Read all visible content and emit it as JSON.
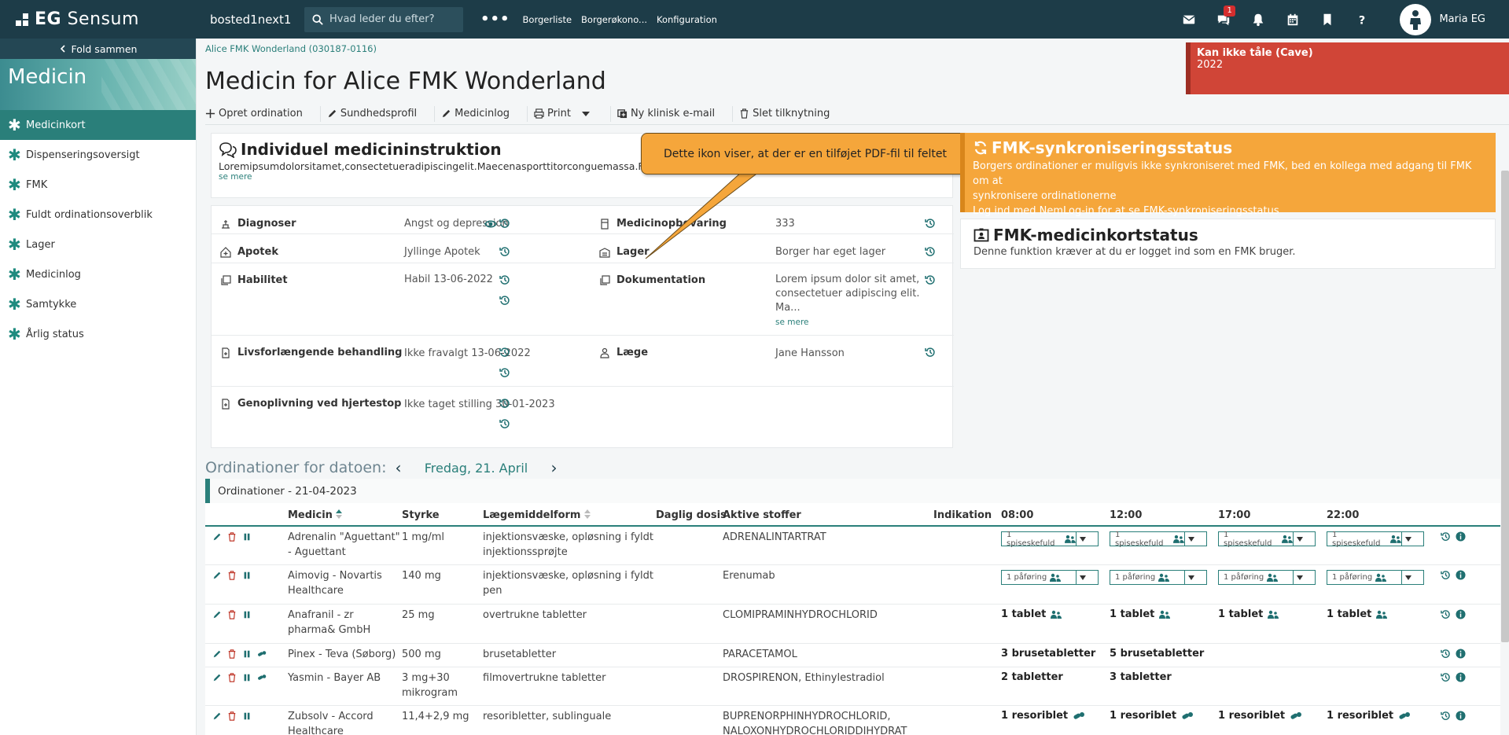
{
  "topbar": {
    "brand_prefix": "EG",
    "brand_name": "Sensum",
    "tenant": "bosted1next1",
    "search_placeholder": "Hvad leder du efter?",
    "more_label": "•••",
    "nav": [
      "Borgerliste",
      "Borgerøkono...",
      "Konfiguration"
    ],
    "chat_badge": "1",
    "user_name": "Maria EG"
  },
  "sidebar": {
    "collapse_label": "Fold sammen",
    "title": "Medicin",
    "items": [
      "Medicinkort",
      "Dispenseringsoversigt",
      "FMK",
      "Fuldt ordinationsoverblik",
      "Lager",
      "Medicinlog",
      "Samtykke",
      "Årlig status"
    ],
    "active_index": 0
  },
  "page": {
    "breadcrumb": "Alice FMK Wonderland (030187-0116)",
    "title": "Medicin for Alice FMK Wonderland",
    "cave_title": "Kan ikke tåle (Cave)",
    "cave_value": "2022",
    "accent_color": "#2a7f7a",
    "warning_color": "#f5a63b",
    "alert_color": "#d04537"
  },
  "actions": [
    "Opret ordination",
    "Sundhedsprofil",
    "Medicinlog",
    "Print",
    "Ny klinisk e-mail",
    "Slet tilknytning"
  ],
  "instruction": {
    "title": "Individuel medicininstruktion",
    "text": "Loremipsumdolorsitamet,consectetueradipiscingelit.Maecenasporttitorconguemassa.Fuscedon",
    "more": "se mere"
  },
  "callout": "Dette ikon viser, at der er en tilføjet PDF-fil til feltet",
  "info": {
    "diagnoser_label": "Diagnoser",
    "diagnoser_value": "Angst og depression",
    "opbevaring_label": "Medicinopbevaring",
    "opbevaring_value": "333",
    "apotek_label": "Apotek",
    "apotek_value": "Jyllinge Apotek",
    "lager_label": "Lager",
    "lager_value": "Borger har eget lager",
    "habilitet_label": "Habilitet",
    "habilitet_value": "Habil 13-06-2022",
    "dokumentation_label": "Dokumentation",
    "dokumentation_value_1": "Lorem ipsum dolor sit amet,",
    "dokumentation_value_2": "consectetuer adipiscing elit.",
    "dokumentation_value_3": "Ma...",
    "dokumentation_more": "se mere",
    "livs_label": "Livsforlængende behandling",
    "livs_value": "Ikke fravalgt 13-06-2022",
    "laege_label": "Læge",
    "laege_value": "Jane Hansson",
    "genoplivning_label": "Genoplivning ved hjertestop",
    "genoplivning_value": "Ikke taget stilling 30-01-2023"
  },
  "sync": {
    "title": "FMK-synkroniseringsstatus",
    "line1": "Borgers ordinationer er muligvis ikke synkroniseret med FMK, bed en kollega med adgang til FMK om at",
    "line2": "synkronisere ordinationerne",
    "line3": "Log ind med NemLog-in for at se FMK-synkroniseringsstatus"
  },
  "fmk": {
    "title": "FMK-medicinkortstatus",
    "text": "Denne funktion kræver at du er logget ind som en FMK bruger."
  },
  "orders": {
    "heading": "Ordinationer for datoen:",
    "date": "Fredag, 21. April",
    "caption": "Ordinationer - 21-04-2023",
    "columns": {
      "medicin": "Medicin",
      "styrke": "Styrke",
      "form": "Lægemiddelform",
      "daglig": "Daglig dosis",
      "stoffer": "Aktive stoffer",
      "indikation": "Indikation",
      "t0800": "08:00",
      "t1200": "12:00",
      "t1700": "17:00",
      "t2200": "22:00"
    },
    "rows": [
      {
        "med1": "Adrenalin \"Aguettant\"",
        "med2": "- Aguettant",
        "styrke1": "1 mg/ml",
        "styrke2": "",
        "form1": "injektionsvæske, opløsning i fyldt",
        "form2": "injektionssprøjte",
        "stof1": "ADRENALINTARTRAT",
        "stof2": "",
        "d1": "1 spiseskefuld",
        "d2": "1 spiseskefuld",
        "d3": "1 spiseskefuld",
        "d4": "1 spiseskefuld"
      },
      {
        "med1": "Aimovig - Novartis",
        "med2": "Healthcare",
        "styrke1": "140 mg",
        "styrke2": "",
        "form1": "injektionsvæske, opløsning i fyldt",
        "form2": "pen",
        "stof1": "Erenumab",
        "stof2": "",
        "d1": "1 påføring",
        "d2": "1 påføring",
        "d3": "1 påføring",
        "d4": "1 påføring"
      },
      {
        "med1": "Anafranil - zr",
        "med2": "pharma& GmbH",
        "styrke1": "25 mg",
        "styrke2": "",
        "form1": "overtrukne tabletter",
        "form2": "",
        "stof1": "CLOMIPRAMINHYDROCHLORID",
        "stof2": "",
        "d1": "1 tablet",
        "d2": "1 tablet",
        "d3": "1 tablet",
        "d4": "1 tablet"
      },
      {
        "med1": "Pinex - Teva (Søborg)",
        "med2": "",
        "styrke1": "500 mg",
        "styrke2": "",
        "form1": "brusetabletter",
        "form2": "",
        "stof1": "PARACETAMOL",
        "stof2": "",
        "d1": "3 brusetabletter",
        "d2": "5 brusetabletter",
        "d3": "",
        "d4": ""
      },
      {
        "med1": "Yasmin - Bayer AB",
        "med2": "",
        "styrke1": "3 mg+30",
        "styrke2": "mikrogram",
        "form1": "filmovertrukne tabletter",
        "form2": "",
        "stof1": "DROSPIRENON, Ethinylestradiol",
        "stof2": "",
        "d1": "2 tabletter",
        "d2": "3 tabletter",
        "d3": "",
        "d4": ""
      },
      {
        "med1": "Zubsolv - Accord",
        "med2": "Healthcare",
        "styrke1": "11,4+2,9 mg",
        "styrke2": "",
        "form1": "resoribletter, sublinguale",
        "form2": "",
        "stof1": "BUPRENORPHINHYDROCHLORID,",
        "stof2": "NALOXONHYDROCHLORIDDIHYDRAT",
        "d1": "1 resoriblet",
        "d2": "1 resoriblet",
        "d3": "1 resoriblet",
        "d4": "1 resoriblet"
      }
    ]
  }
}
